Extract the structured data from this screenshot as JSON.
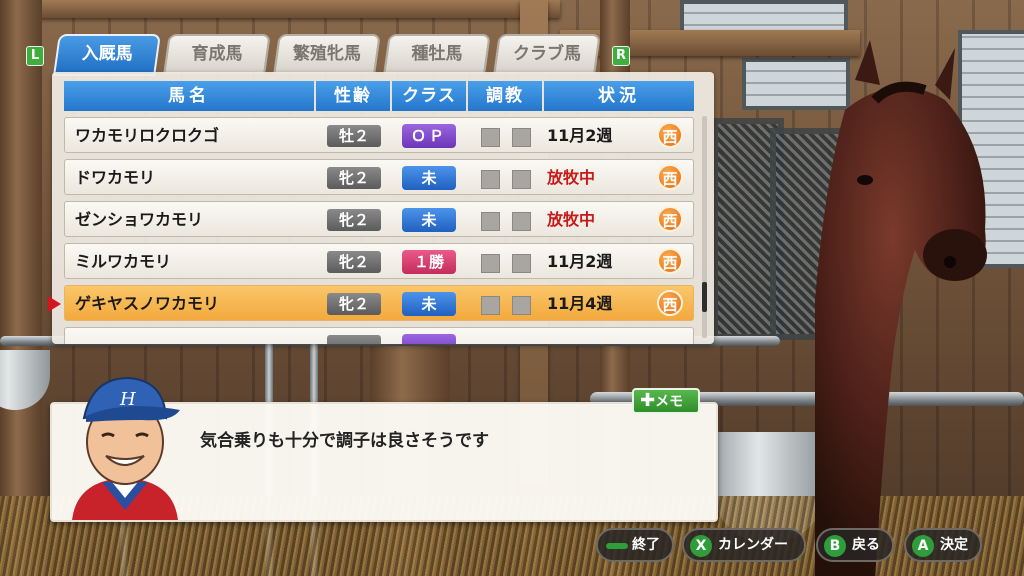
{
  "tabs": [
    {
      "label": "入厩馬",
      "active": true
    },
    {
      "label": "育成馬",
      "active": false
    },
    {
      "label": "繁殖牝馬",
      "active": false
    },
    {
      "label": "種牡馬",
      "active": false
    },
    {
      "label": "クラブ馬",
      "active": false
    }
  ],
  "shoulder": {
    "left": "L",
    "right": "R"
  },
  "columns": {
    "name": "馬名",
    "sex_age": "性齢",
    "class": "クラス",
    "training": "調教",
    "status": "状況"
  },
  "horses": [
    {
      "name": "ワカモリロクロクゴ",
      "sex_age": "牡２",
      "class": "ＯＰ",
      "status": "11月2週",
      "region": "西"
    },
    {
      "name": "ドワカモリ",
      "sex_age": "牝２",
      "class": "未",
      "status": "放牧中",
      "region": "西"
    },
    {
      "name": "ゼンショワカモリ",
      "sex_age": "牝２",
      "class": "未",
      "status": "放牧中",
      "region": "西"
    },
    {
      "name": "ミルワカモリ",
      "sex_age": "牝２",
      "class": "１勝",
      "status": "11月2週",
      "region": "西"
    },
    {
      "name": "ゲキヤスノワカモリ",
      "sex_age": "牝２",
      "class": "未",
      "status": "11月4週",
      "region": "西"
    }
  ],
  "selected_row": 4,
  "memo_label": "メモ",
  "message": "気合乗りも十分で調子は良さそうです",
  "buttons": [
    {
      "glyph": "−",
      "label": "終了"
    },
    {
      "glyph": "X",
      "label": "カレンダー"
    },
    {
      "glyph": "B",
      "label": "戻る"
    },
    {
      "glyph": "A",
      "label": "決定"
    }
  ],
  "colors": {
    "tab_active": "#2476cc",
    "header": "#2476cc",
    "selected_row": "#f3a93d",
    "status_red": "#c81818",
    "button_green": "#2f9d3a"
  }
}
